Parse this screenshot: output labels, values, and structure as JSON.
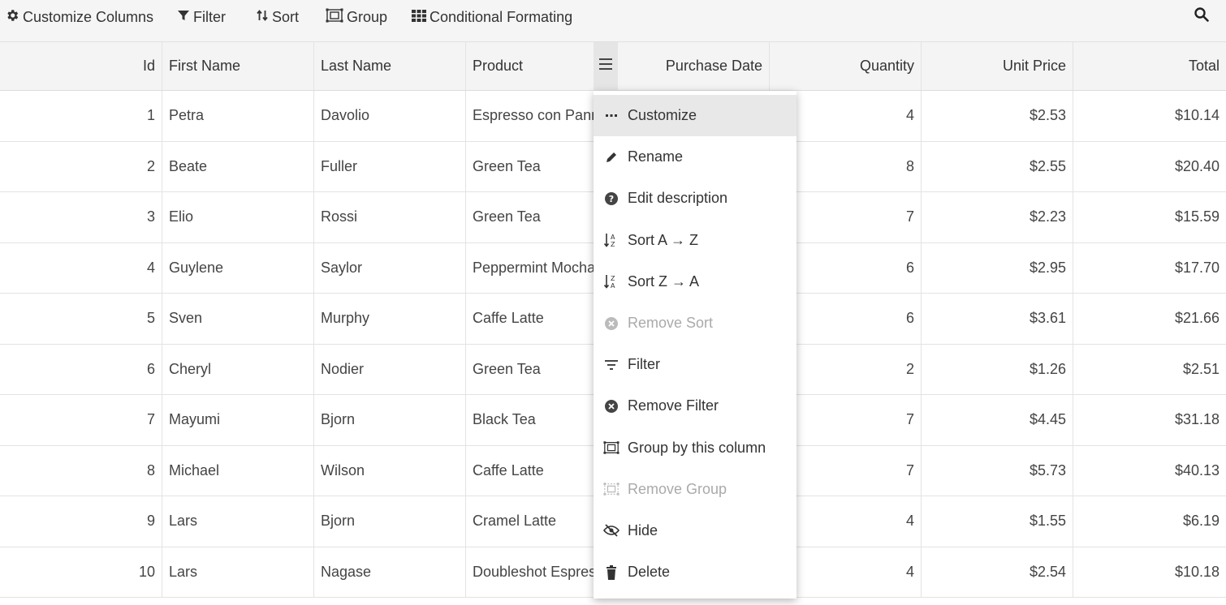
{
  "toolbar": {
    "customize_columns": "Customize Columns",
    "filter": "Filter",
    "sort": "Sort",
    "group": "Group",
    "conditional_formatting": "Conditional Formating"
  },
  "columns": [
    "Id",
    "First Name",
    "Last Name",
    "Product",
    "Purchase Date",
    "Quantity",
    "Unit Price",
    "Total"
  ],
  "rows": [
    {
      "id": "1",
      "first": "Petra",
      "last": "Davolio",
      "product": "Espresso con Panna",
      "date": "",
      "qty": "4",
      "price": "$2.53",
      "total": "$10.14"
    },
    {
      "id": "2",
      "first": "Beate",
      "last": "Fuller",
      "product": "Green Tea",
      "date": "",
      "qty": "8",
      "price": "$2.55",
      "total": "$20.40"
    },
    {
      "id": "3",
      "first": "Elio",
      "last": "Rossi",
      "product": "Green Tea",
      "date": "",
      "qty": "7",
      "price": "$2.23",
      "total": "$15.59"
    },
    {
      "id": "4",
      "first": "Guylene",
      "last": "Saylor",
      "product": "Peppermint Mocha",
      "date": "",
      "qty": "6",
      "price": "$2.95",
      "total": "$17.70"
    },
    {
      "id": "5",
      "first": "Sven",
      "last": "Murphy",
      "product": "Caffe Latte",
      "date": "",
      "qty": "6",
      "price": "$3.61",
      "total": "$21.66"
    },
    {
      "id": "6",
      "first": "Cheryl",
      "last": "Nodier",
      "product": "Green Tea",
      "date": "",
      "qty": "2",
      "price": "$1.26",
      "total": "$2.51"
    },
    {
      "id": "7",
      "first": "Mayumi",
      "last": "Bjorn",
      "product": "Black Tea",
      "date": "",
      "qty": "7",
      "price": "$4.45",
      "total": "$31.18"
    },
    {
      "id": "8",
      "first": "Michael",
      "last": "Wilson",
      "product": "Caffe Latte",
      "date": "",
      "qty": "7",
      "price": "$5.73",
      "total": "$40.13"
    },
    {
      "id": "9",
      "first": "Lars",
      "last": "Bjorn",
      "product": "Cramel Latte",
      "date": "",
      "qty": "4",
      "price": "$1.55",
      "total": "$6.19"
    },
    {
      "id": "10",
      "first": "Lars",
      "last": "Nagase",
      "product": "Doubleshot Espresso",
      "date": "",
      "qty": "4",
      "price": "$2.54",
      "total": "$10.18"
    }
  ],
  "menu": {
    "items": [
      {
        "label": "Customize",
        "icon": "ellipsis-icon",
        "state": "active"
      },
      {
        "label": "Rename",
        "icon": "pencil-icon",
        "state": "enabled"
      },
      {
        "label": "Edit description",
        "icon": "question-circle-icon",
        "state": "enabled"
      },
      {
        "label": "Sort A → Z",
        "icon": "sort-az-icon",
        "state": "enabled"
      },
      {
        "label": "Sort Z → A",
        "icon": "sort-za-icon",
        "state": "enabled"
      },
      {
        "label": "Remove Sort",
        "icon": "x-circle-icon",
        "state": "disabled"
      },
      {
        "label": "Filter",
        "icon": "filter-lines-icon",
        "state": "enabled"
      },
      {
        "label": "Remove Filter",
        "icon": "x-circle-icon",
        "state": "enabled"
      },
      {
        "label": "Group by this column",
        "icon": "group-icon",
        "state": "enabled"
      },
      {
        "label": "Remove Group",
        "icon": "group-icon",
        "state": "disabled"
      },
      {
        "label": "Hide",
        "icon": "eye-slash-icon",
        "state": "enabled"
      },
      {
        "label": "Delete",
        "icon": "trash-icon",
        "state": "enabled"
      }
    ]
  },
  "colors": {
    "toolbar_bg": "#f5f5f5",
    "header_bg": "#f4f4f4",
    "menu_active_bg": "#e8e8e8",
    "disabled_text": "#aaaaaa"
  }
}
